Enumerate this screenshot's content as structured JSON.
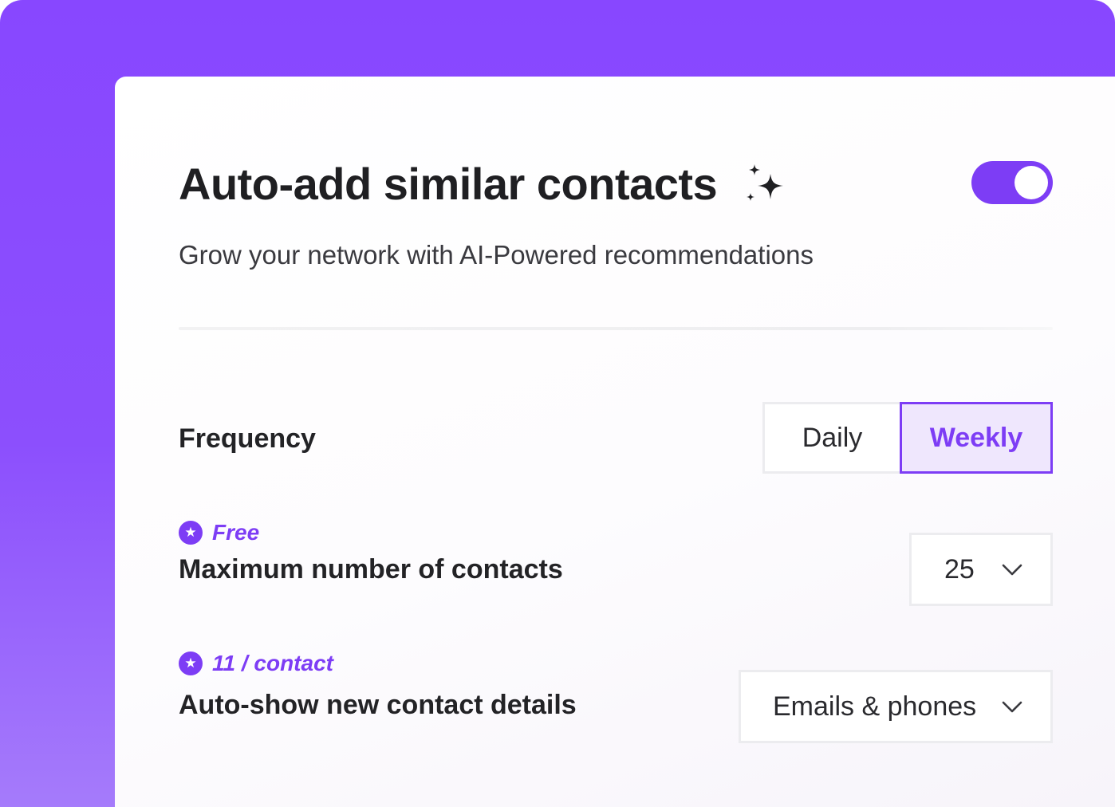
{
  "header": {
    "title": "Auto-add similar contacts",
    "sparkle_icon": "sparkles-icon",
    "subtitle": "Grow your network with AI-Powered recommendations",
    "toggle_on": true
  },
  "frequency": {
    "label": "Frequency",
    "options": [
      "Daily",
      "Weekly"
    ],
    "selected": "Weekly"
  },
  "max_contacts": {
    "badge": "Free",
    "badge_icon": "star-icon",
    "label": "Maximum number of contacts",
    "value": "25",
    "dropdown_icon": "chevron-down-icon"
  },
  "contact_details": {
    "badge": "11 / contact",
    "badge_icon": "star-icon",
    "label": "Auto-show new contact details",
    "value": "Emails & phones",
    "dropdown_icon": "chevron-down-icon"
  },
  "colors": {
    "accent": "#7d3df5",
    "background": "#8847ff",
    "selected_fill": "#efe7fd"
  }
}
